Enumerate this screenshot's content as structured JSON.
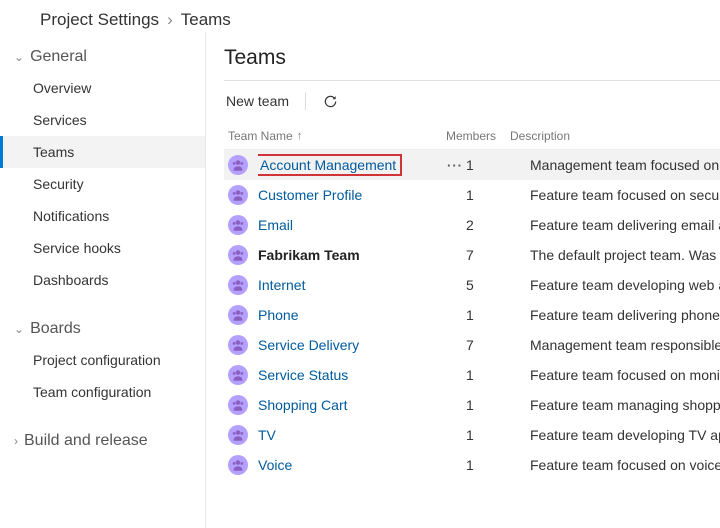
{
  "breadcrumb": {
    "parent": "Project Settings",
    "current": "Teams"
  },
  "sidebar": {
    "sections": [
      {
        "title": "General",
        "expanded": true,
        "items": [
          {
            "label": "Overview",
            "selected": false
          },
          {
            "label": "Services",
            "selected": false
          },
          {
            "label": "Teams",
            "selected": true
          },
          {
            "label": "Security",
            "selected": false
          },
          {
            "label": "Notifications",
            "selected": false
          },
          {
            "label": "Service hooks",
            "selected": false
          },
          {
            "label": "Dashboards",
            "selected": false
          }
        ]
      },
      {
        "title": "Boards",
        "expanded": true,
        "items": [
          {
            "label": "Project configuration",
            "selected": false
          },
          {
            "label": "Team configuration",
            "selected": false
          }
        ]
      },
      {
        "title": "Build and release",
        "expanded": false,
        "items": []
      }
    ]
  },
  "page": {
    "title": "Teams"
  },
  "toolbar": {
    "new_team_label": "New team",
    "refresh_label": "Refresh"
  },
  "table": {
    "headers": {
      "name": "Team Name",
      "members": "Members",
      "description": "Description",
      "sort_indicator": "↑"
    },
    "rows": [
      {
        "name": "Account Management",
        "members": "1",
        "description": "Management team focused on creating an",
        "bold": false,
        "highlighted": true,
        "hovered": true
      },
      {
        "name": "Customer Profile",
        "members": "1",
        "description": "Feature team focused on securing accoun",
        "bold": false,
        "highlighted": false,
        "hovered": false
      },
      {
        "name": "Email",
        "members": "2",
        "description": "Feature team delivering email apps",
        "bold": false,
        "highlighted": false,
        "hovered": false
      },
      {
        "name": "Fabrikam Team",
        "members": "7",
        "description": "The default project team. Was Fabrikam Fi",
        "bold": true,
        "highlighted": false,
        "hovered": false
      },
      {
        "name": "Internet",
        "members": "5",
        "description": "Feature team developing web apps",
        "bold": false,
        "highlighted": false,
        "hovered": false
      },
      {
        "name": "Phone",
        "members": "1",
        "description": "Feature team delivering phone apps",
        "bold": false,
        "highlighted": false,
        "hovered": false
      },
      {
        "name": "Service Delivery",
        "members": "7",
        "description": "Management team responsible for ensure",
        "bold": false,
        "highlighted": false,
        "hovered": false
      },
      {
        "name": "Service Status",
        "members": "1",
        "description": "Feature team focused on monitoring and a",
        "bold": false,
        "highlighted": false,
        "hovered": false
      },
      {
        "name": "Shopping Cart",
        "members": "1",
        "description": "Feature team managing shopping cart app",
        "bold": false,
        "highlighted": false,
        "hovered": false
      },
      {
        "name": "TV",
        "members": "1",
        "description": "Feature team developing TV apps",
        "bold": false,
        "highlighted": false,
        "hovered": false
      },
      {
        "name": "Voice",
        "members": "1",
        "description": "Feature team focused on voice communic",
        "bold": false,
        "highlighted": false,
        "hovered": false
      }
    ]
  }
}
